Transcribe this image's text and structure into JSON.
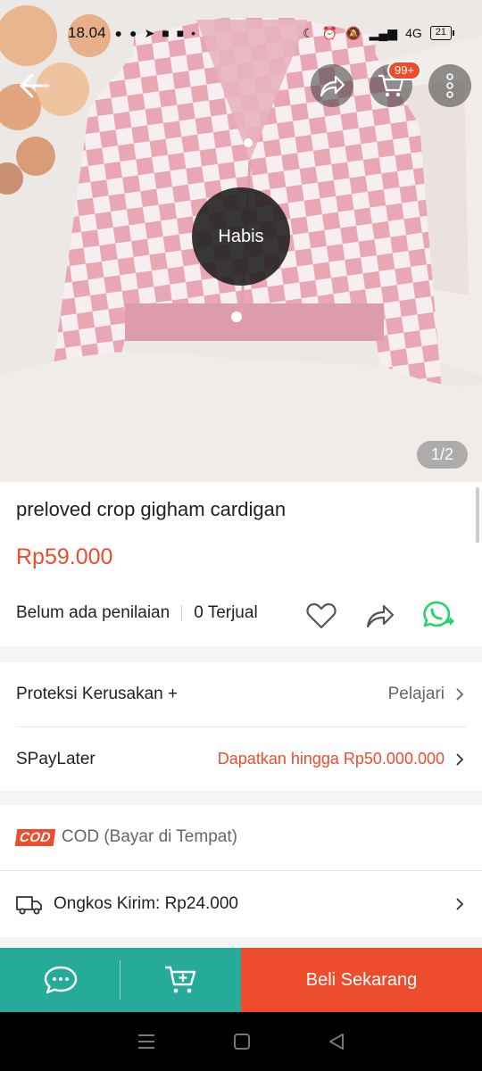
{
  "status_bar": {
    "time": "18.04",
    "network": "4G",
    "battery": "21"
  },
  "top_bar": {
    "cart_badge": "99+"
  },
  "image": {
    "overlay_label": "Habis",
    "counter": "1/2"
  },
  "product": {
    "title": "preloved crop gigham cardigan",
    "price": "Rp59.000",
    "rating_text": "Belum ada penilaian",
    "sold_text": "0 Terjual"
  },
  "rows": {
    "protection": {
      "label": "Proteksi Kerusakan +",
      "value": "Pelajari"
    },
    "paylater": {
      "label": "SPayLater",
      "value": "Dapatkan hingga Rp50.000.000"
    },
    "cod": {
      "badge": "COD",
      "label": "COD (Bayar di Tempat)"
    },
    "shipping": {
      "label": "Ongkos Kirim: Rp24.000"
    }
  },
  "bottom_bar": {
    "buy_label": "Beli Sekarang"
  },
  "colors": {
    "accent": "#ee4d2d",
    "teal": "#26aa99",
    "whatsapp": "#25d366"
  }
}
